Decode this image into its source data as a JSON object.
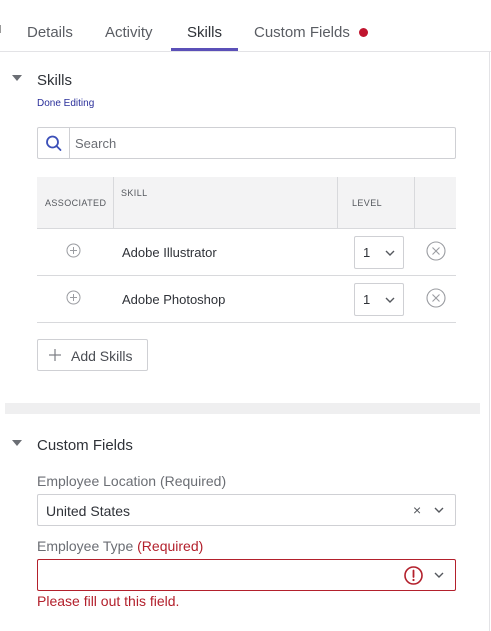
{
  "tabs": [
    {
      "label": "Details"
    },
    {
      "label": "Activity"
    },
    {
      "label": "Skills"
    },
    {
      "label": "Custom Fields"
    }
  ],
  "active_tab": "Skills",
  "skills_section": {
    "title": "Skills",
    "done_link": "Done Editing",
    "search_placeholder": "Search",
    "columns": [
      "ASSOCIATED",
      "SKILL",
      "LEVEL"
    ],
    "rows": [
      {
        "skill": "Adobe Illustrator",
        "level": "1"
      },
      {
        "skill": "Adobe Photoshop",
        "level": "1"
      }
    ],
    "add_button": "Add Skills"
  },
  "custom_fields_section": {
    "title": "Custom Fields",
    "location": {
      "label": "Employee Location (Required)",
      "value": "United States",
      "clear_icon": "×"
    },
    "type": {
      "label": "Employee Type",
      "required_tag": "(Required)",
      "value": "",
      "error": "Please fill out this field."
    }
  },
  "colors": {
    "accent": "#5b50b8",
    "error": "#b3202c",
    "link": "#2a2f9a"
  },
  "icons": [
    "search-icon",
    "plus-circle-icon",
    "chevron-down-icon",
    "close-circle-icon",
    "plus-icon",
    "error-circle-icon",
    "clear-icon"
  ]
}
